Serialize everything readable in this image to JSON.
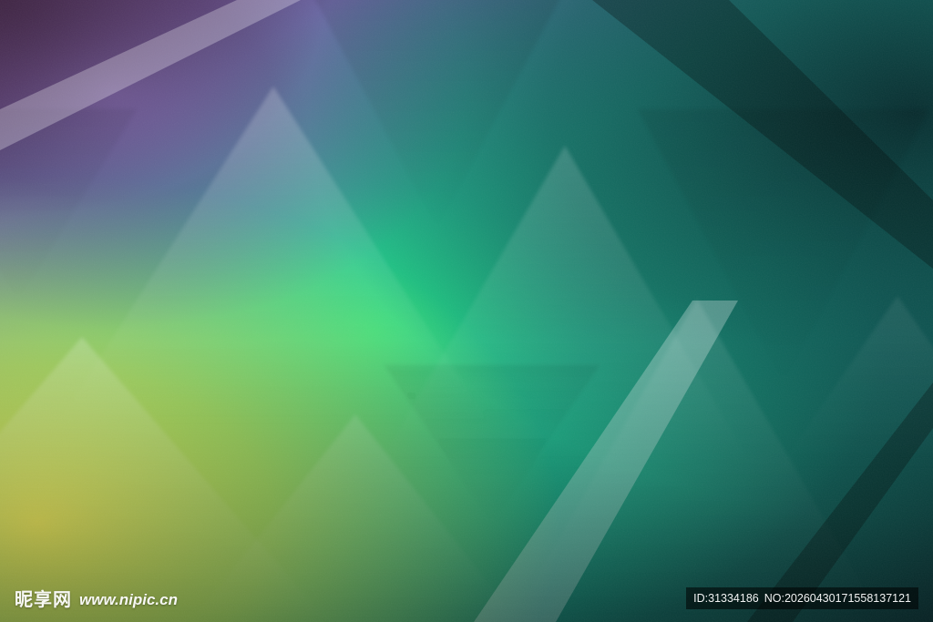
{
  "image": {
    "subject": "gradient-triangle-abstract-background",
    "colors": {
      "top_left": "#5a2b4c",
      "purple_band": "#7b6db6",
      "left_yellow": "#d5df4e",
      "center_green": "#1fd27b",
      "teal": "#21b3a3",
      "deep_teal": "#0c4d5c",
      "dark_right": "#0b3a38",
      "bottom_dark": "#0a3b35"
    }
  },
  "watermark": {
    "brand": "昵享网",
    "site": "www.nipic.cn",
    "id_label": "ID:31334186",
    "no_label": "NO:20260430171558137121"
  }
}
